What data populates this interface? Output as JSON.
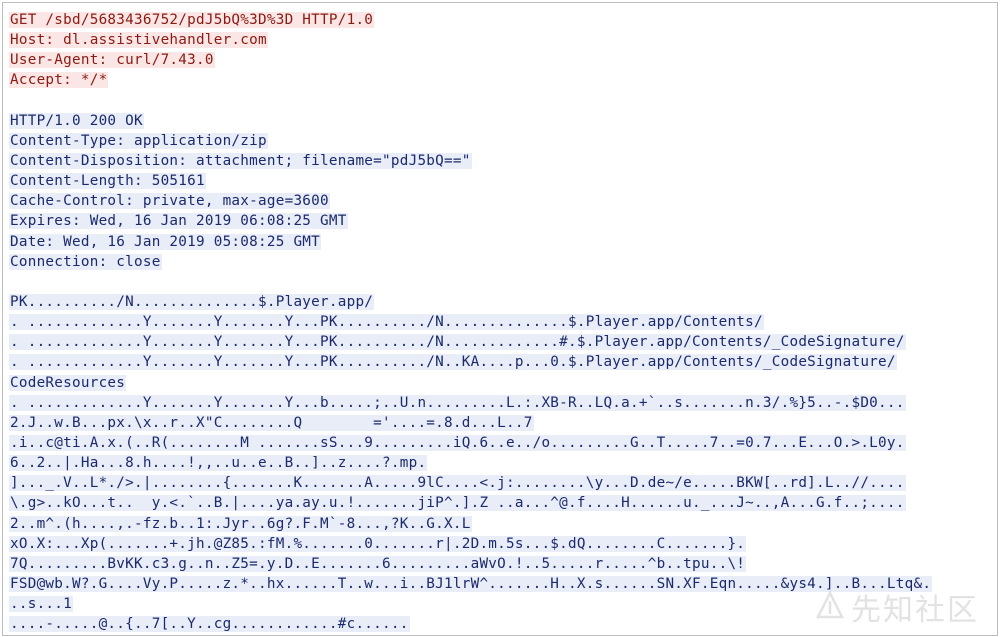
{
  "request": [
    "GET /sbd/5683436752/pdJ5bQ%3D%3D HTTP/1.0",
    "Host: dl.assistivehandler.com",
    "User-Agent: curl/7.43.0",
    "Accept: */*"
  ],
  "response_headers": [
    "HTTP/1.0 200 OK",
    "Content-Type: application/zip",
    "Content-Disposition: attachment; filename=\"pdJ5bQ==\"",
    "Content-Length: 505161",
    "Cache-Control: private, max-age=3600",
    "Expires: Wed, 16 Jan 2019 06:08:25 GMT",
    "Date: Wed, 16 Jan 2019 05:08:25 GMT",
    "Connection: close"
  ],
  "response_body": [
    "PK........../N..............$.Player.app/",
    ". .............Y.......Y.......Y...PK........../N..............$.Player.app/Contents/",
    ". .............Y.......Y.......Y...PK........../N.............#.$.Player.app/Contents/_CodeSignature/",
    ". .............Y.......Y.......Y...PK........../N..KA....p...0.$.Player.app/Contents/_CodeSignature/",
    "CodeResources",
    ". .............Y.......Y.......Y...b.....;..U.n.........L.:.XB-R..LQ.a.+`..s.......n.3/.%}5..-.$D0...",
    "2.J..w.B...px.\\x..r..X\"C........Q        ='....=.8.d...L..7",
    ".i..c@ti.A.x.(..R(........M .......sS...9.........iQ.6..e../o.........G..T.....7..=0.7...E...O.>.L0y.",
    "6..2..|.Ha...8.h....!,,..u..e..B..]..z....?.mp.",
    "]..._.V..L*./>.|........{.......K.......A.....9lC....<.j:........\\y...D.de~/e.....BKW[..rd].L..//....",
    "\\.g>..kO...t..  y.<.`..B.|....ya.ay.u.!.......jiP^.].Z ..a...^@.f....H......u._...J~..,A...G.f..;....",
    "2..m^.(h....,.-fz.b..1:.Jyr..6g?.F.M`-8...,?K..G.X.L",
    "xO.X:...Xp(.......+.jh.@Z85.:fM.%.......0.......r|.2D.m.5s...$.dQ........C.......}.",
    "7Q.........BvKK.c3.g..n..Z5=.y.D..E.......6.........aWvO.!..5.....r.....^b..tpu..\\!",
    "FSD@wb.W?.G....Vy.P.....z.*..hx......T..w...i..BJ1lrW^.......H..X.s......SN.XF.Eqn.....&ys4.]..B...Ltq&.",
    "..s...1",
    "....-.....@..{..7[..Y..cg............#c......"
  ],
  "watermark": {
    "text": "先知社区",
    "icon": "xianzhi-logo-icon"
  }
}
